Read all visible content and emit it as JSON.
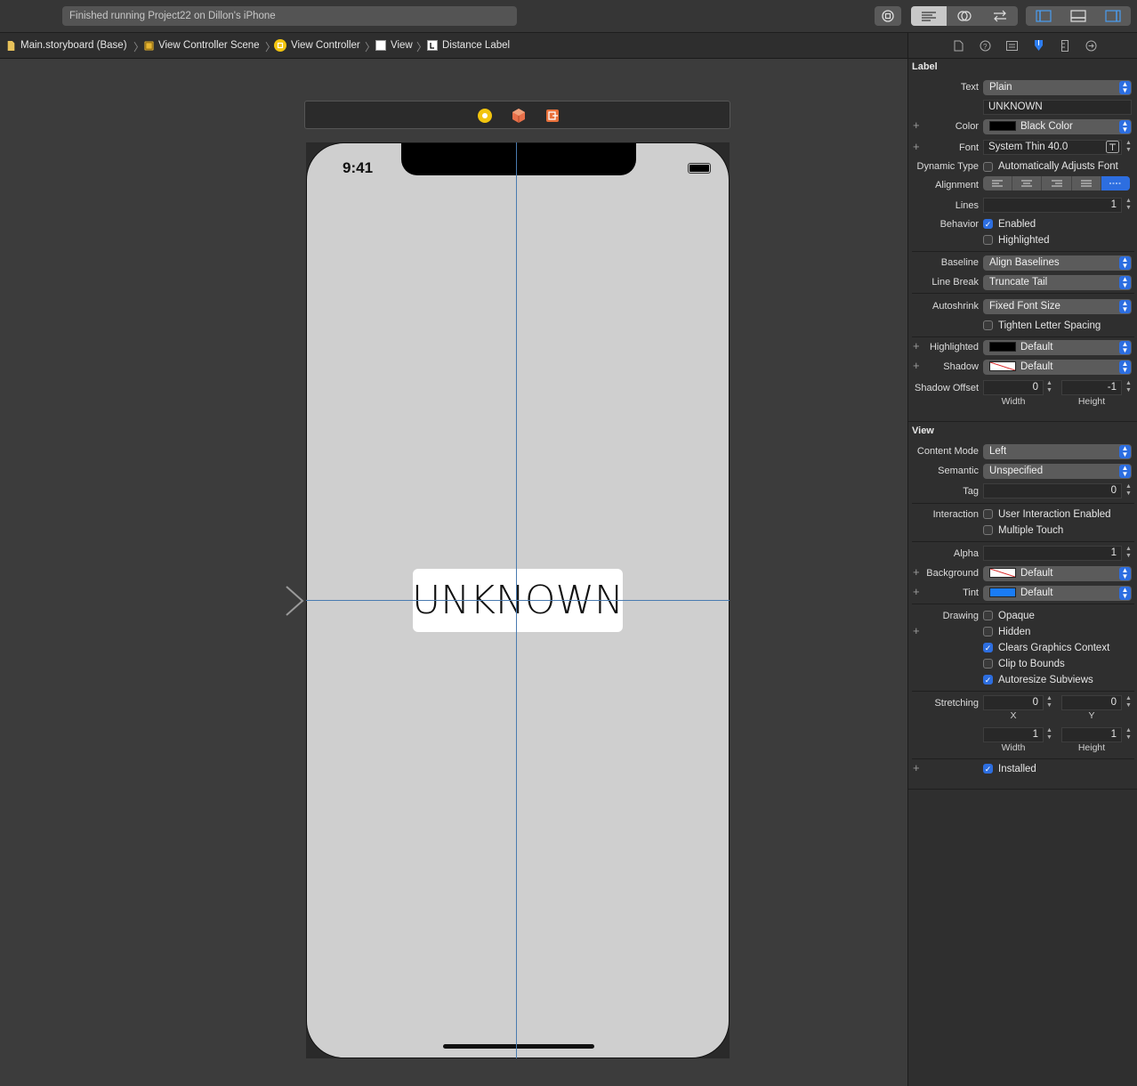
{
  "toolbar": {
    "status_text": "Finished running Project22 on Dillon's iPhone"
  },
  "breadcrumb": {
    "items": [
      "Main.storyboard (Base)",
      "View Controller Scene",
      "View Controller",
      "View",
      "Distance Label"
    ]
  },
  "device": {
    "time": "9:41",
    "label_text": "UNKNOWN"
  },
  "inspector": {
    "label_section": {
      "title": "Label",
      "text_label": "Text",
      "text_value": "Plain",
      "text_content": "UNKNOWN",
      "color_label": "Color",
      "color_value": "Black Color",
      "font_label": "Font",
      "font_value": "System Thin 40.0",
      "dynamic_type_label": "Dynamic Type",
      "dynamic_type_option": "Automatically Adjusts Font",
      "alignment_label": "Alignment",
      "lines_label": "Lines",
      "lines_value": "1",
      "behavior_label": "Behavior",
      "enabled_label": "Enabled",
      "highlighted_check_label": "Highlighted",
      "baseline_label": "Baseline",
      "baseline_value": "Align Baselines",
      "line_break_label": "Line Break",
      "line_break_value": "Truncate Tail",
      "autoshrink_label": "Autoshrink",
      "autoshrink_value": "Fixed Font Size",
      "tighten_label": "Tighten Letter Spacing",
      "highlighted_label": "Highlighted",
      "highlighted_value": "Default",
      "shadow_label": "Shadow",
      "shadow_value": "Default",
      "shadow_offset_label": "Shadow Offset",
      "shadow_offset_width": "0",
      "shadow_offset_height": "-1",
      "width_label": "Width",
      "height_label": "Height"
    },
    "view_section": {
      "title": "View",
      "content_mode_label": "Content Mode",
      "content_mode_value": "Left",
      "semantic_label": "Semantic",
      "semantic_value": "Unspecified",
      "tag_label": "Tag",
      "tag_value": "0",
      "interaction_label": "Interaction",
      "user_interaction_label": "User Interaction Enabled",
      "multiple_touch_label": "Multiple Touch",
      "alpha_label": "Alpha",
      "alpha_value": "1",
      "background_label": "Background",
      "background_value": "Default",
      "tint_label": "Tint",
      "tint_value": "Default",
      "drawing_label": "Drawing",
      "opaque_label": "Opaque",
      "hidden_label": "Hidden",
      "clears_label": "Clears Graphics Context",
      "clip_label": "Clip to Bounds",
      "autoresize_label": "Autoresize Subviews",
      "stretching_label": "Stretching",
      "stretch_x": "0",
      "stretch_y": "0",
      "x_label": "X",
      "y_label": "Y",
      "stretch_w": "1",
      "stretch_h": "1",
      "width_label": "Width",
      "height_label": "Height",
      "installed_label": "Installed"
    }
  },
  "colors": {
    "accent": "#2d6ee0",
    "guide_line": "#4a7bb0",
    "canvas_bg": "#3c3c3c"
  }
}
